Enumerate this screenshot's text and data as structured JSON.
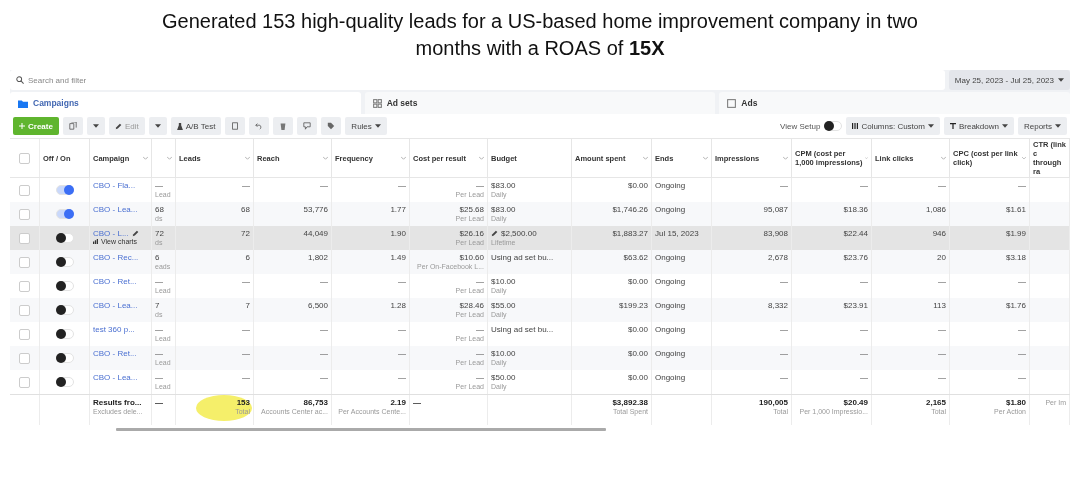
{
  "headline": "Generated 153 high-quality leads for a US-based home improvement company in two months with a ROAS of **15X**",
  "search": {
    "placeholder": "Search and filter"
  },
  "date_range": "May 25, 2023 - Jul 25, 2023",
  "tabs": [
    {
      "label": "Campaigns",
      "selected": true
    },
    {
      "label": "Ad sets",
      "selected": false
    },
    {
      "label": "Ads",
      "selected": false
    }
  ],
  "toolbar": {
    "create": "Create",
    "edit": "Edit",
    "ab_test": "A/B Test",
    "rules": "Rules",
    "view_setup": "View Setup",
    "view_setup_on": false,
    "columns": "Columns: Custom",
    "breakdown": "Breakdown",
    "reports": "Reports"
  },
  "table": {
    "all_checked": false,
    "columns": [
      {
        "label": "Off / On",
        "sortable": false
      },
      {
        "label": "Campaign",
        "sortable": true
      },
      {
        "sortable": true
      },
      {
        "label": "Leads",
        "sortable": true
      },
      {
        "label": "Reach",
        "sortable": true
      },
      {
        "label": "Frequency",
        "sortable": true
      },
      {
        "label": "Cost per result",
        "sortable": true
      },
      {
        "label": "Budget",
        "sortable": false
      },
      {
        "label": "Amount spent",
        "sortable": true
      },
      {
        "label": "Ends",
        "sortable": true
      },
      {
        "label": "Impressions",
        "sortable": true
      },
      {
        "label": "CPM (cost per 1,000 impressions)",
        "sortable": true
      },
      {
        "label": "Link clicks",
        "sortable": true
      },
      {
        "label": "CPC (cost per link click)",
        "sortable": true
      },
      {
        "label": "CTR (link c through ra",
        "sortable": false
      }
    ],
    "rows": [
      {
        "checked": false,
        "hovered": false,
        "cells": [
          {
            "kind": "toggle",
            "on": true
          },
          {
            "kind": "campaign",
            "value": "CBO - Fla..."
          },
          {
            "value": "—",
            "note": "Lead"
          },
          {
            "value": "—"
          },
          {
            "value": "—"
          },
          {
            "value": "—"
          },
          {
            "value": "—",
            "note": "Per Lead"
          },
          {
            "value": "$83.00",
            "note": "Daily"
          },
          {
            "value": "$0.00"
          },
          {
            "value": "Ongoing"
          },
          {
            "value": "—"
          },
          {
            "value": "—"
          },
          {
            "value": "—"
          },
          {
            "value": "—"
          }
        ]
      },
      {
        "checked": false,
        "hovered": false,
        "cells": [
          {
            "kind": "toggle",
            "on": true
          },
          {
            "kind": "campaign",
            "value": "CBO - Lea..."
          },
          {
            "value": "68",
            "note": "ds"
          },
          {
            "value": "68"
          },
          {
            "value": "53,776"
          },
          {
            "value": "1.77"
          },
          {
            "value": "$25.68",
            "note": "Per Lead"
          },
          {
            "value": "$83.00",
            "note": "Daily"
          },
          {
            "value": "$1,746.26"
          },
          {
            "value": "Ongoing"
          },
          {
            "value": "95,087"
          },
          {
            "value": "$18.36"
          },
          {
            "value": "1,086"
          },
          {
            "value": "$1.61"
          }
        ]
      },
      {
        "checked": false,
        "hovered": true,
        "cells": [
          {
            "kind": "toggle",
            "on": false
          },
          {
            "kind": "campaign",
            "value": "CBO - L...",
            "action": "View charts"
          },
          {
            "value": "72",
            "note": "ds"
          },
          {
            "value": "72"
          },
          {
            "value": "44,049"
          },
          {
            "value": "1.90"
          },
          {
            "value": "$26.16",
            "note": "Per Lead"
          },
          {
            "value": "$2,500.00",
            "note": "Lifetime"
          },
          {
            "value": "$1,883.27"
          },
          {
            "value": "Jul 15, 2023"
          },
          {
            "value": "83,908"
          },
          {
            "value": "$22.44"
          },
          {
            "value": "946"
          },
          {
            "value": "$1.99"
          }
        ]
      },
      {
        "checked": false,
        "hovered": false,
        "cells": [
          {
            "kind": "toggle",
            "on": false
          },
          {
            "kind": "campaign",
            "value": "CBO - Rec..."
          },
          {
            "value": "6",
            "note": "eads"
          },
          {
            "value": "6"
          },
          {
            "value": "1,802"
          },
          {
            "value": "1.49"
          },
          {
            "value": "$10.60",
            "note": "Per On-Facebook L..."
          },
          {
            "value": "Using ad set bu..."
          },
          {
            "value": "$63.62"
          },
          {
            "value": "Ongoing"
          },
          {
            "value": "2,678"
          },
          {
            "value": "$23.76"
          },
          {
            "value": "20"
          },
          {
            "value": "$3.18"
          }
        ]
      },
      {
        "checked": false,
        "hovered": false,
        "cells": [
          {
            "kind": "toggle",
            "on": false
          },
          {
            "kind": "campaign",
            "value": "CBO - Ret..."
          },
          {
            "value": "—",
            "note": "Lead"
          },
          {
            "value": "—"
          },
          {
            "value": "—"
          },
          {
            "value": "—"
          },
          {
            "value": "—",
            "note": "Per Lead"
          },
          {
            "value": "$10.00",
            "note": "Daily"
          },
          {
            "value": "$0.00"
          },
          {
            "value": "Ongoing"
          },
          {
            "value": "—"
          },
          {
            "value": "—"
          },
          {
            "value": "—"
          },
          {
            "value": "—"
          }
        ]
      },
      {
        "checked": false,
        "hovered": false,
        "cells": [
          {
            "kind": "toggle",
            "on": false
          },
          {
            "kind": "campaign",
            "value": "CBO - Lea..."
          },
          {
            "value": "7",
            "note": "ds"
          },
          {
            "value": "7"
          },
          {
            "value": "6,500"
          },
          {
            "value": "1.28"
          },
          {
            "value": "$28.46",
            "note": "Per Lead"
          },
          {
            "value": "$55.00",
            "note": "Daily"
          },
          {
            "value": "$199.23"
          },
          {
            "value": "Ongoing"
          },
          {
            "value": "8,332"
          },
          {
            "value": "$23.91"
          },
          {
            "value": "113"
          },
          {
            "value": "$1.76"
          }
        ]
      },
      {
        "checked": false,
        "hovered": false,
        "cells": [
          {
            "kind": "toggle",
            "on": false
          },
          {
            "kind": "campaign",
            "value": "test 360 p..."
          },
          {
            "value": "—",
            "note": "Lead"
          },
          {
            "value": "—"
          },
          {
            "value": "—"
          },
          {
            "value": "—"
          },
          {
            "value": "—",
            "note": "Per Lead"
          },
          {
            "value": "Using ad set bu..."
          },
          {
            "value": "$0.00"
          },
          {
            "value": "Ongoing"
          },
          {
            "value": "—"
          },
          {
            "value": "—"
          },
          {
            "value": "—"
          },
          {
            "value": "—"
          }
        ]
      },
      {
        "checked": false,
        "hovered": false,
        "cells": [
          {
            "kind": "toggle",
            "on": false
          },
          {
            "kind": "campaign",
            "value": "CBO - Ret..."
          },
          {
            "value": "—",
            "note": "Lead"
          },
          {
            "value": "—"
          },
          {
            "value": "—"
          },
          {
            "value": "—"
          },
          {
            "value": "—",
            "note": "Per Lead"
          },
          {
            "value": "$10.00",
            "note": "Daily"
          },
          {
            "value": "$0.00"
          },
          {
            "value": "Ongoing"
          },
          {
            "value": "—"
          },
          {
            "value": "—"
          },
          {
            "value": "—"
          },
          {
            "value": "—"
          }
        ]
      },
      {
        "checked": false,
        "hovered": false,
        "cells": [
          {
            "kind": "toggle",
            "on": false
          },
          {
            "kind": "campaign",
            "value": "CBO - Lea..."
          },
          {
            "value": "—",
            "note": "Lead"
          },
          {
            "value": "—"
          },
          {
            "value": "—"
          },
          {
            "value": "—"
          },
          {
            "value": "—",
            "note": "Per Lead"
          },
          {
            "value": "$50.00",
            "note": "Daily"
          },
          {
            "value": "$0.00"
          },
          {
            "value": "Ongoing"
          },
          {
            "value": "—"
          },
          {
            "value": "—"
          },
          {
            "value": "—"
          },
          {
            "value": "—"
          }
        ]
      }
    ],
    "totals": {
      "cells": [
        {
          "highlighted": false
        },
        {
          "value": "Results fro...",
          "note": "Excludes dele...",
          "highlighted": false
        },
        {
          "value": "—",
          "highlighted": false
        },
        {
          "value": "153",
          "note": "Total",
          "highlighted": true
        },
        {
          "value": "86,753",
          "note": "Accounts Center ac...",
          "highlighted": false
        },
        {
          "value": "2.19",
          "note": "Per Accounts Cente...",
          "highlighted": false
        },
        {
          "value": "—",
          "highlighted": false
        },
        {
          "highlighted": false
        },
        {
          "value": "$3,892.38",
          "note": "Total Spent",
          "highlighted": false
        },
        {
          "highlighted": false
        },
        {
          "value": "190,005",
          "note": "Total",
          "highlighted": false
        },
        {
          "value": "$20.49",
          "note": "Per 1,000 Impressio...",
          "highlighted": false
        },
        {
          "value": "2,165",
          "note": "Total",
          "highlighted": false
        },
        {
          "value": "$1.80",
          "note": "Per Action",
          "highlighted": false
        },
        {
          "note": "Per Im",
          "highlighted": false
        }
      ]
    }
  }
}
